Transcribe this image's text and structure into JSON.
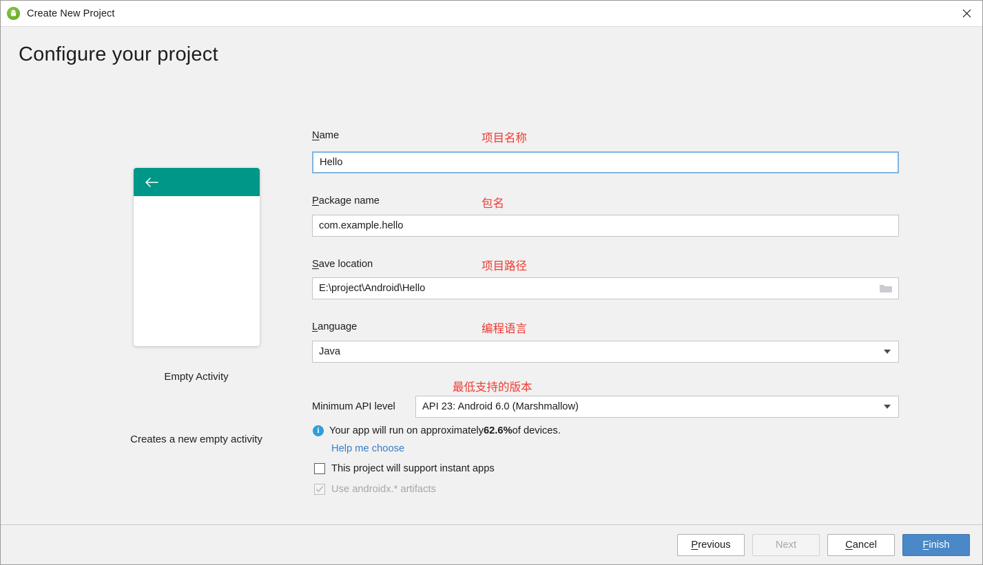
{
  "titlebar": {
    "title": "Create New Project",
    "app_icon": "android-studio-icon",
    "close_icon": "close-icon"
  },
  "page": {
    "heading": "Configure your project"
  },
  "preview": {
    "back_icon": "back-arrow-icon",
    "template_name": "Empty Activity",
    "template_description": "Creates a new empty activity",
    "appbar_color": "#009688"
  },
  "form": {
    "name": {
      "label": "Name",
      "mnemonic": "N",
      "value": "Hello",
      "annotation": "项目名称"
    },
    "package_name": {
      "label": "Package name",
      "mnemonic": "P",
      "value": "com.example.hello",
      "annotation": "包名"
    },
    "save_location": {
      "label": "Save location",
      "mnemonic": "S",
      "value": "E:\\project\\Android\\Hello",
      "annotation": "项目路径",
      "browse_icon": "folder-icon"
    },
    "language": {
      "label": "Language",
      "mnemonic": "L",
      "value": "Java",
      "annotation": "编程语言",
      "dropdown_icon": "chevron-down-icon"
    },
    "minimum_api": {
      "label": "Minimum API level",
      "value": "API 23: Android 6.0 (Marshmallow)",
      "annotation": "最低支持的版本",
      "dropdown_icon": "chevron-down-icon"
    },
    "device_info": {
      "icon": "info-icon",
      "prefix": "Your app will run on approximately ",
      "percent": "62.6%",
      "suffix": " of devices."
    },
    "help_link": "Help me choose",
    "instant_apps": {
      "label": "This project will support instant apps",
      "checked": false
    },
    "androidx": {
      "label": "Use androidx.* artifacts",
      "checked": true,
      "disabled": true
    }
  },
  "footer": {
    "previous": {
      "label": "Previous",
      "mnemonic": "P"
    },
    "next": {
      "label": "Next",
      "disabled": true
    },
    "cancel": {
      "label": "Cancel",
      "mnemonic": "C"
    },
    "finish": {
      "label": "Finish",
      "mnemonic": "F",
      "color": "#4a88c7"
    }
  },
  "annotation_color": "#ee3b33"
}
